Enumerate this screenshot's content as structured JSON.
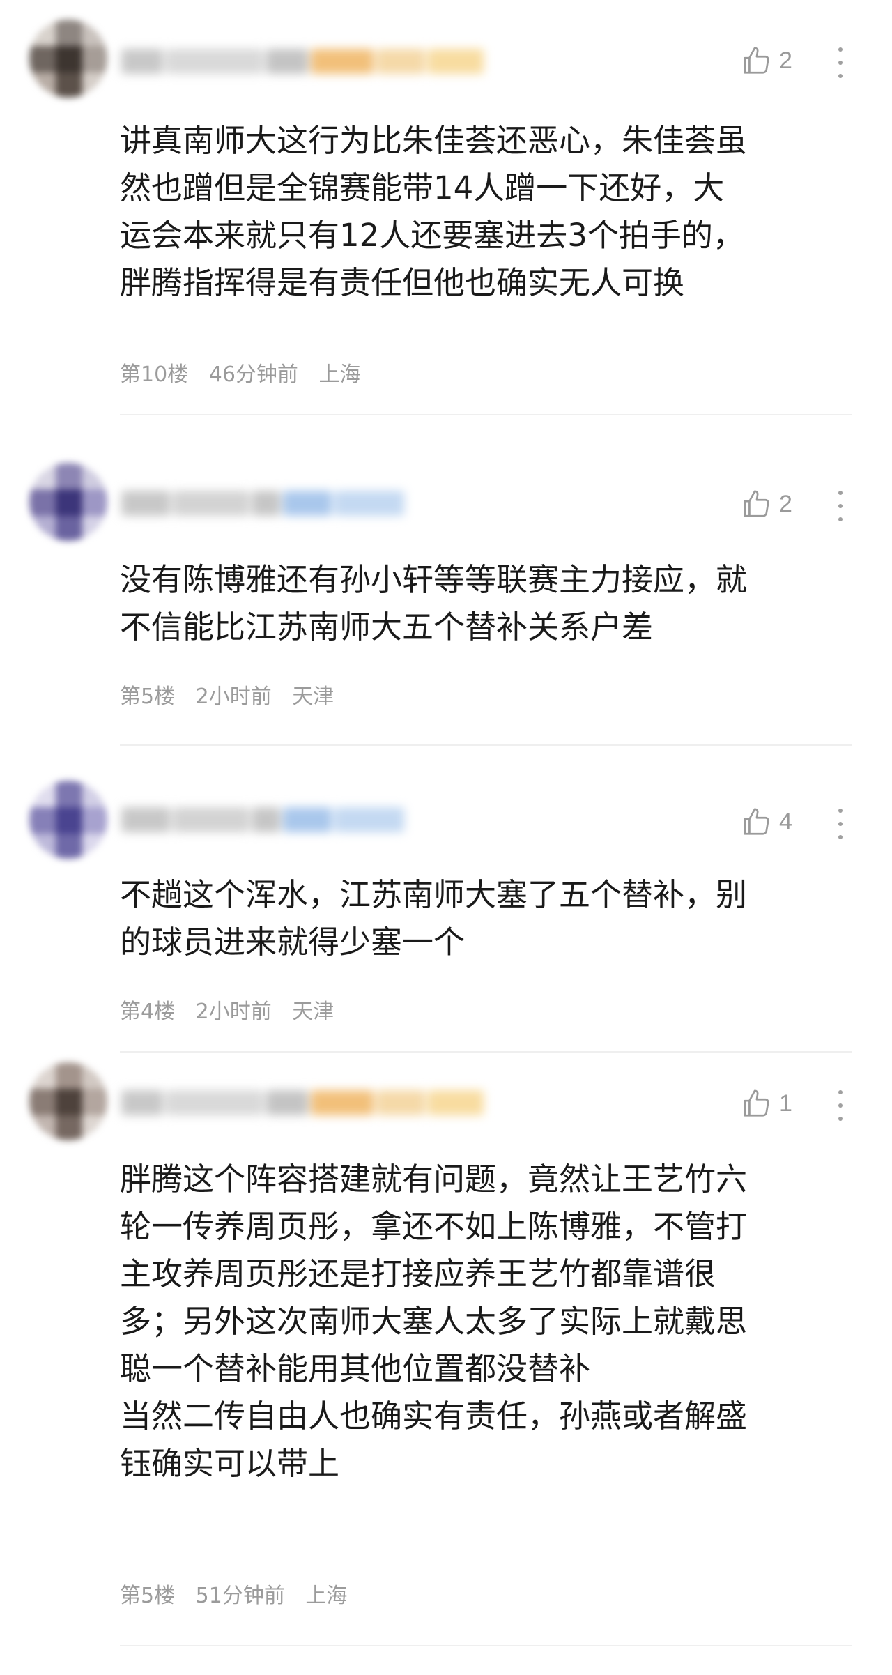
{
  "comments": [
    {
      "like_count": "2",
      "text_lines": [
        "讲真南师大这行为比朱佳荟还恶心，朱佳荟虽",
        "然也蹭但是全锦赛能带14人蹭一下还好，大",
        "运会本来就只有12人还要塞进去3个拍手的，",
        "胖腾指挥得是有责任但他也确实无人可换"
      ],
      "floor": "第10楼",
      "time": "46分钟前",
      "location": "上海"
    },
    {
      "like_count": "2",
      "text_lines": [
        "没有陈博雅还有孙小轩等等联赛主力接应，就",
        "不信能比江苏南师大五个替补关系户差"
      ],
      "floor": "第5楼",
      "time": "2小时前",
      "location": "天津"
    },
    {
      "like_count": "4",
      "text_lines": [
        "不趟这个浑水，江苏南师大塞了五个替补，别",
        "的球员进来就得少塞一个"
      ],
      "floor": "第4楼",
      "time": "2小时前",
      "location": "天津"
    },
    {
      "like_count": "1",
      "text_lines": [
        "胖腾这个阵容搭建就有问题，竟然让王艺竹六",
        "轮一传养周页彤，拿还不如上陈博雅，不管打",
        "主攻养周页彤还是打接应养王艺竹都靠谱很",
        "多；另外这次南师大塞人太多了实际上就戴思",
        "聪一个替补能用其他位置都没替补",
        "当然二传自由人也确实有责任，孙燕或者解盛",
        "钰确实可以带上"
      ],
      "floor": "第5楼",
      "time": "51分钟前",
      "location": "上海"
    }
  ],
  "icons": {
    "like": "thumbs-up-icon",
    "more": "more-vertical-icon",
    "avatar": "avatar-blurred",
    "username": "username-blurred"
  },
  "colors": {
    "text": "#1a1a1a",
    "meta": "#9b9b9b",
    "divider": "#efefef",
    "icon": "#9a9a9a"
  }
}
